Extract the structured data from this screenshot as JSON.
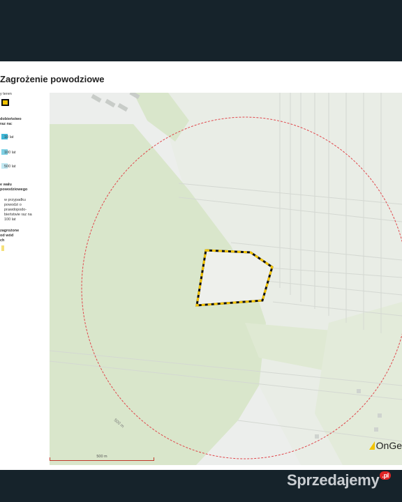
{
  "document": {
    "title": "Zagrożenie powodziowe"
  },
  "legend": {
    "plot_label": "y teren",
    "probability_heading": "dobieństwo\nraz na:",
    "items": [
      {
        "label": "10 lat",
        "color": "#3fb6d6"
      },
      {
        "label": "100 lat",
        "color": "#7fd0e4"
      },
      {
        "label": "500 lat",
        "color": "#c2e8f2"
      }
    ],
    "water_heading": "e wału\npowodziowego",
    "water_text": "w przypadku\npowodzi o\nprawdopodo-\nbieństwie raz na\n100 lat",
    "threatened_text": "zagrożone\nod wód\nch"
  },
  "map": {
    "radius_label": "500 m",
    "scale_label": "500 m",
    "brand": "OnGe"
  },
  "colors": {
    "forest": "#d9e6cb",
    "meadow": "#e7eee0",
    "background": "#eceeec",
    "plot_border": "#f2c300",
    "buffer_ring": "#e0474c"
  },
  "watermark": {
    "text": "Sprzedajemy",
    "suffix": ".pl"
  }
}
